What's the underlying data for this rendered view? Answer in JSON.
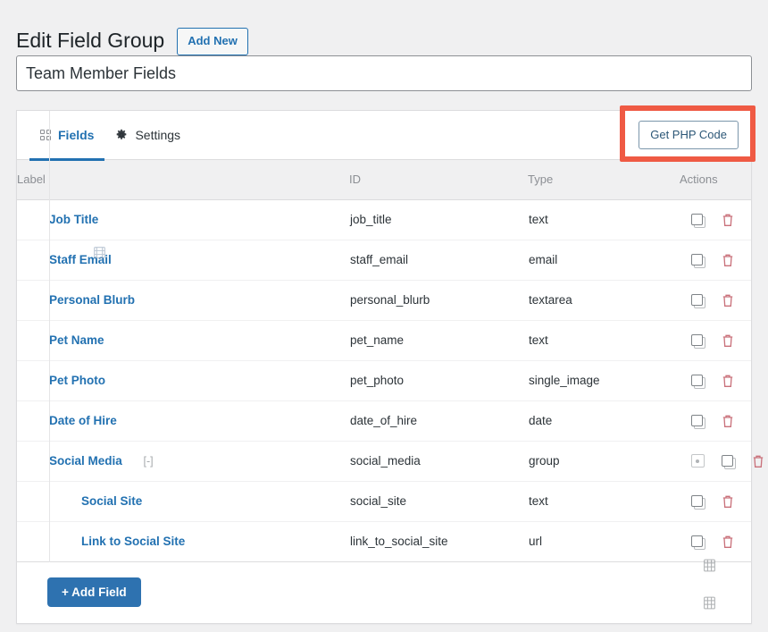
{
  "header": {
    "title": "Edit Field Group",
    "add_new_label": "Add New"
  },
  "title_field": {
    "value": "Team Member Fields",
    "placeholder": "Add title"
  },
  "tabs": [
    {
      "label": "Fields",
      "icon": "grid-icon",
      "active": true
    },
    {
      "label": "Settings",
      "icon": "gear-icon",
      "active": false
    }
  ],
  "toolbar": {
    "get_php_code_label": "Get PHP Code",
    "highlight_color": "#ef5a44"
  },
  "table": {
    "columns": [
      "Label",
      "ID",
      "Type",
      "Actions"
    ],
    "rows": [
      {
        "label": "Job Title",
        "id": "job_title",
        "type": "text",
        "level": 0,
        "toggle": ""
      },
      {
        "label": "Staff Email",
        "id": "staff_email",
        "type": "email",
        "level": 0,
        "toggle": ""
      },
      {
        "label": "Personal Blurb",
        "id": "personal_blurb",
        "type": "textarea",
        "level": 0,
        "toggle": ""
      },
      {
        "label": "Pet Name",
        "id": "pet_name",
        "type": "text",
        "level": 0,
        "toggle": ""
      },
      {
        "label": "Pet Photo",
        "id": "pet_photo",
        "type": "single_image",
        "level": 0,
        "toggle": ""
      },
      {
        "label": "Date of Hire",
        "id": "date_of_hire",
        "type": "date",
        "level": 0,
        "toggle": ""
      },
      {
        "label": "Social Media",
        "id": "social_media",
        "type": "group",
        "level": 0,
        "toggle": "[-]"
      },
      {
        "label": "Social Site",
        "id": "social_site",
        "type": "text",
        "level": 1,
        "toggle": ""
      },
      {
        "label": "Link to Social Site",
        "id": "link_to_social_site",
        "type": "url",
        "level": 1,
        "toggle": ""
      }
    ]
  },
  "footer": {
    "add_field_label": "+ Add Field",
    "add_field_color": "#2e72b0"
  },
  "colors": {
    "accent": "#2271b1",
    "page_background": "#f0f0f1",
    "panel_background": "#ffffff",
    "border": "#dcdcde",
    "delete": "#c9707a"
  }
}
